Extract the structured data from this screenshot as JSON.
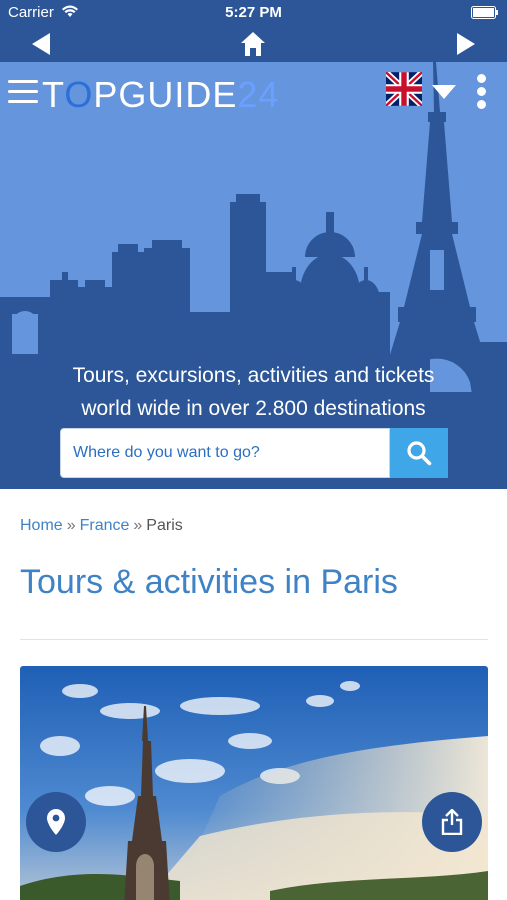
{
  "status_bar": {
    "carrier": "Carrier",
    "time": "5:27 PM"
  },
  "nav": {
    "back_icon": "back-arrow-icon",
    "home_icon": "home-icon",
    "forward_icon": "forward-arrow-icon"
  },
  "header": {
    "logo": {
      "part1": "T",
      "part2": "O",
      "part3": "PGUIDE",
      "part4": "24"
    },
    "language_flag": "uk-flag-icon"
  },
  "hero": {
    "title_line1": "Tours, excursions, activities and tickets",
    "title_line2": "world wide in over 2.800 destinations",
    "search_placeholder": "Where do you want to go?"
  },
  "breadcrumb": {
    "items": [
      "Home",
      "France",
      "Paris"
    ],
    "separator": "»"
  },
  "main": {
    "page_title": "Tours & activities in Paris"
  },
  "colors": {
    "brand_dark": "#2c5697",
    "sky": "#6595dd",
    "accent": "#3fa7e8",
    "link": "#3f83c6"
  }
}
